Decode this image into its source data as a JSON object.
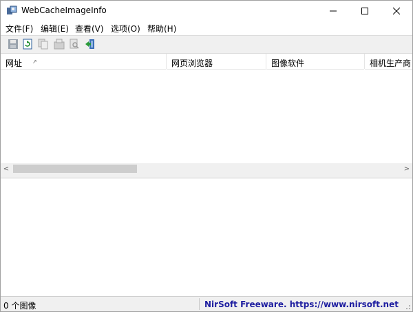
{
  "window": {
    "title": "WebCacheImageInfo",
    "app_icon": "webcache-app-icon",
    "controls": [
      "minimize-icon",
      "maximize-icon",
      "close-icon"
    ]
  },
  "menu": {
    "items": [
      "文件(F)",
      "编辑(E)",
      "查看(V)",
      "选项(O)",
      "帮助(H)"
    ]
  },
  "toolbar": {
    "buttons": [
      "save-icon",
      "refresh-icon",
      "copy-icon",
      "properties-icon",
      "find-icon",
      "exit-icon"
    ]
  },
  "table": {
    "columns": [
      "网址",
      "网页浏览器",
      "图像软件",
      "相机生产商"
    ],
    "sort_indicator": "↗",
    "rows": []
  },
  "scrollbar": {
    "left_arrow": "<",
    "right_arrow": ">"
  },
  "status": {
    "count_text": "0 个图像",
    "link_text": "NirSoft Freeware. https://www.nirsoft.net"
  },
  "colors": {
    "link": "#1e1ea0",
    "toolbar_bg": "#f0f0f0",
    "scroll_thumb": "#cdcdcd"
  }
}
